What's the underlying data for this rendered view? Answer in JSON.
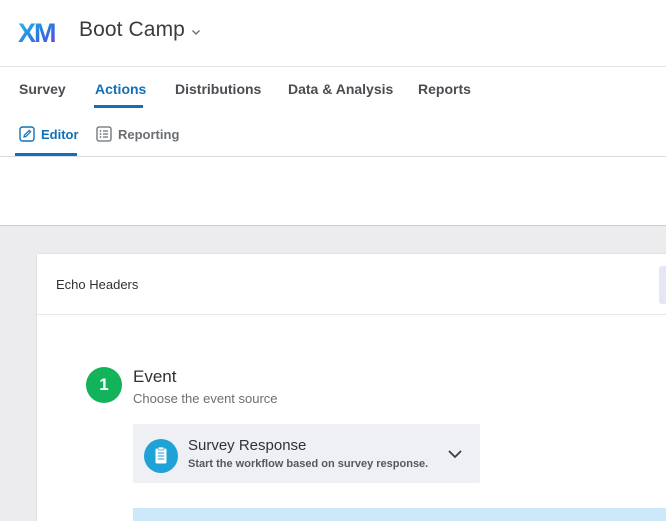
{
  "header": {
    "logo_text": "XM",
    "project_name": "Boot Camp",
    "project_menu_icon": "chevron-down-icon"
  },
  "tabs": [
    {
      "label": "Survey",
      "active": false
    },
    {
      "label": "Actions",
      "active": true
    },
    {
      "label": "Distributions",
      "active": false
    },
    {
      "label": "Data & Analysis",
      "active": false
    },
    {
      "label": "Reports",
      "active": false
    }
  ],
  "subtabs": [
    {
      "label": "Editor",
      "icon": "pencil-icon",
      "active": true
    },
    {
      "label": "Reporting",
      "icon": "list-icon",
      "active": false
    }
  ],
  "workflow": {
    "title": "Echo Headers",
    "step": {
      "number": "1",
      "title": "Event",
      "subtitle": "Choose the event source",
      "event": {
        "title": "Survey Response",
        "description": "Start the workflow based on survey response.",
        "icon": "clipboard-icon"
      }
    }
  },
  "colors": {
    "accent": "#1170b8",
    "step_badge": "#12b35a",
    "event_icon": "#1fa2d6",
    "canvas": "#ececee"
  }
}
